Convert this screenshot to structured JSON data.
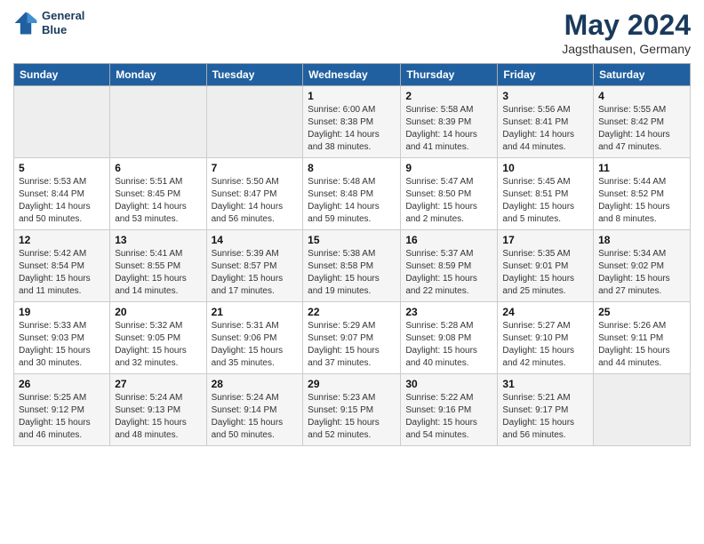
{
  "logo": {
    "line1": "General",
    "line2": "Blue"
  },
  "title": "May 2024",
  "location": "Jagsthausen, Germany",
  "days_header": [
    "Sunday",
    "Monday",
    "Tuesday",
    "Wednesday",
    "Thursday",
    "Friday",
    "Saturday"
  ],
  "weeks": [
    [
      {
        "num": "",
        "info": ""
      },
      {
        "num": "",
        "info": ""
      },
      {
        "num": "",
        "info": ""
      },
      {
        "num": "1",
        "info": "Sunrise: 6:00 AM\nSunset: 8:38 PM\nDaylight: 14 hours\nand 38 minutes."
      },
      {
        "num": "2",
        "info": "Sunrise: 5:58 AM\nSunset: 8:39 PM\nDaylight: 14 hours\nand 41 minutes."
      },
      {
        "num": "3",
        "info": "Sunrise: 5:56 AM\nSunset: 8:41 PM\nDaylight: 14 hours\nand 44 minutes."
      },
      {
        "num": "4",
        "info": "Sunrise: 5:55 AM\nSunset: 8:42 PM\nDaylight: 14 hours\nand 47 minutes."
      }
    ],
    [
      {
        "num": "5",
        "info": "Sunrise: 5:53 AM\nSunset: 8:44 PM\nDaylight: 14 hours\nand 50 minutes."
      },
      {
        "num": "6",
        "info": "Sunrise: 5:51 AM\nSunset: 8:45 PM\nDaylight: 14 hours\nand 53 minutes."
      },
      {
        "num": "7",
        "info": "Sunrise: 5:50 AM\nSunset: 8:47 PM\nDaylight: 14 hours\nand 56 minutes."
      },
      {
        "num": "8",
        "info": "Sunrise: 5:48 AM\nSunset: 8:48 PM\nDaylight: 14 hours\nand 59 minutes."
      },
      {
        "num": "9",
        "info": "Sunrise: 5:47 AM\nSunset: 8:50 PM\nDaylight: 15 hours\nand 2 minutes."
      },
      {
        "num": "10",
        "info": "Sunrise: 5:45 AM\nSunset: 8:51 PM\nDaylight: 15 hours\nand 5 minutes."
      },
      {
        "num": "11",
        "info": "Sunrise: 5:44 AM\nSunset: 8:52 PM\nDaylight: 15 hours\nand 8 minutes."
      }
    ],
    [
      {
        "num": "12",
        "info": "Sunrise: 5:42 AM\nSunset: 8:54 PM\nDaylight: 15 hours\nand 11 minutes."
      },
      {
        "num": "13",
        "info": "Sunrise: 5:41 AM\nSunset: 8:55 PM\nDaylight: 15 hours\nand 14 minutes."
      },
      {
        "num": "14",
        "info": "Sunrise: 5:39 AM\nSunset: 8:57 PM\nDaylight: 15 hours\nand 17 minutes."
      },
      {
        "num": "15",
        "info": "Sunrise: 5:38 AM\nSunset: 8:58 PM\nDaylight: 15 hours\nand 19 minutes."
      },
      {
        "num": "16",
        "info": "Sunrise: 5:37 AM\nSunset: 8:59 PM\nDaylight: 15 hours\nand 22 minutes."
      },
      {
        "num": "17",
        "info": "Sunrise: 5:35 AM\nSunset: 9:01 PM\nDaylight: 15 hours\nand 25 minutes."
      },
      {
        "num": "18",
        "info": "Sunrise: 5:34 AM\nSunset: 9:02 PM\nDaylight: 15 hours\nand 27 minutes."
      }
    ],
    [
      {
        "num": "19",
        "info": "Sunrise: 5:33 AM\nSunset: 9:03 PM\nDaylight: 15 hours\nand 30 minutes."
      },
      {
        "num": "20",
        "info": "Sunrise: 5:32 AM\nSunset: 9:05 PM\nDaylight: 15 hours\nand 32 minutes."
      },
      {
        "num": "21",
        "info": "Sunrise: 5:31 AM\nSunset: 9:06 PM\nDaylight: 15 hours\nand 35 minutes."
      },
      {
        "num": "22",
        "info": "Sunrise: 5:29 AM\nSunset: 9:07 PM\nDaylight: 15 hours\nand 37 minutes."
      },
      {
        "num": "23",
        "info": "Sunrise: 5:28 AM\nSunset: 9:08 PM\nDaylight: 15 hours\nand 40 minutes."
      },
      {
        "num": "24",
        "info": "Sunrise: 5:27 AM\nSunset: 9:10 PM\nDaylight: 15 hours\nand 42 minutes."
      },
      {
        "num": "25",
        "info": "Sunrise: 5:26 AM\nSunset: 9:11 PM\nDaylight: 15 hours\nand 44 minutes."
      }
    ],
    [
      {
        "num": "26",
        "info": "Sunrise: 5:25 AM\nSunset: 9:12 PM\nDaylight: 15 hours\nand 46 minutes."
      },
      {
        "num": "27",
        "info": "Sunrise: 5:24 AM\nSunset: 9:13 PM\nDaylight: 15 hours\nand 48 minutes."
      },
      {
        "num": "28",
        "info": "Sunrise: 5:24 AM\nSunset: 9:14 PM\nDaylight: 15 hours\nand 50 minutes."
      },
      {
        "num": "29",
        "info": "Sunrise: 5:23 AM\nSunset: 9:15 PM\nDaylight: 15 hours\nand 52 minutes."
      },
      {
        "num": "30",
        "info": "Sunrise: 5:22 AM\nSunset: 9:16 PM\nDaylight: 15 hours\nand 54 minutes."
      },
      {
        "num": "31",
        "info": "Sunrise: 5:21 AM\nSunset: 9:17 PM\nDaylight: 15 hours\nand 56 minutes."
      },
      {
        "num": "",
        "info": ""
      }
    ]
  ]
}
